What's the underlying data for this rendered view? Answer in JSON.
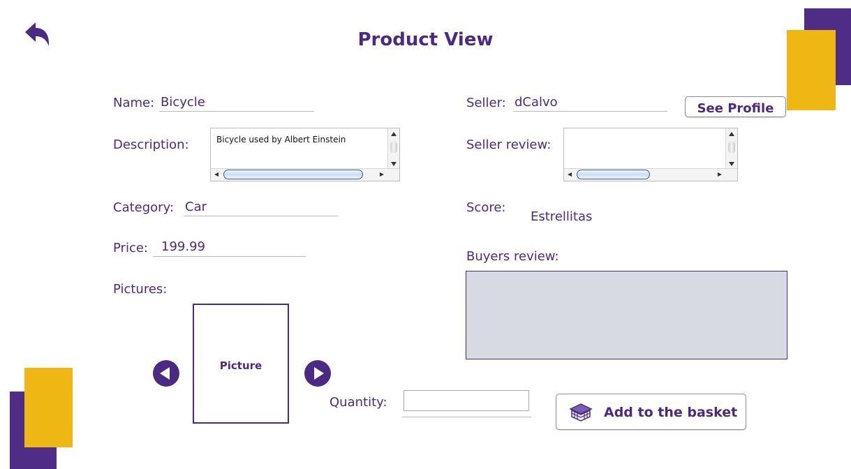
{
  "header": {
    "title": "Product View",
    "back_icon": "back-arrow-icon"
  },
  "product": {
    "name_label": "Name:",
    "name_value": "Bicycle",
    "description_label": "Description:",
    "description_value": "Bicycle used by Albert Einstein",
    "category_label": "Category:",
    "category_value": "Car",
    "price_label": "Price:",
    "price_value": "199.99",
    "pictures_label": "Pictures:",
    "picture_placeholder": "Picture"
  },
  "seller": {
    "seller_label": "Seller:",
    "seller_value": "dCalvo",
    "see_profile_label": "See Profile",
    "seller_review_label": "Seller review:",
    "seller_review_value": "",
    "score_label": "Score:",
    "score_value": "Estrellitas",
    "buyers_review_label": "Buyers review:"
  },
  "purchase": {
    "quantity_label": "Quantity:",
    "quantity_value": "",
    "add_to_basket_label": "Add to the basket",
    "basket_icon": "basket-icon"
  },
  "colors": {
    "primary": "#4b2a83",
    "accent": "#efb713",
    "deco_purple": "#4f2d86",
    "review_background": "#d7d9e3"
  }
}
